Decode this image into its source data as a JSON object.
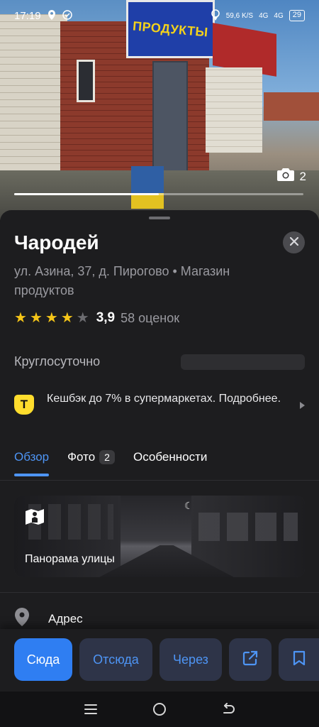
{
  "status_bar": {
    "time": "17:19",
    "network_speed": "59,6 K/S",
    "signal_1": "4G",
    "signal_2": "4G",
    "battery": "29"
  },
  "photo": {
    "sign_text": "ПРОДУКТЫ",
    "count": "2",
    "progress_fraction": 0.5
  },
  "place": {
    "title": "Чародей",
    "subtitle": "ул. Азина, 37, д. Пирогово • Магазин продуктов",
    "rating": "3,9",
    "rating_count": "58 оценок",
    "stars_filled": 4,
    "stars_total": 5,
    "hours": "Круглосуточно"
  },
  "promo": {
    "badge": "Т",
    "text": "Кешбэк до 7% в супермаркетах. Подробнее."
  },
  "tabs": [
    {
      "label": "Обзор",
      "active": true
    },
    {
      "label": "Фото",
      "badge": "2"
    },
    {
      "label": "Особенности"
    }
  ],
  "panorama": {
    "label": "Панорама улицы"
  },
  "address": {
    "label": "Адрес"
  },
  "actions": {
    "to_here": "Сюда",
    "from_here": "Отсюда",
    "via": "Через"
  },
  "colors": {
    "accent": "#4e95f5",
    "primary_button": "#2f7ef2",
    "star_filled": "#f5c518",
    "star_empty": "#6c6c70",
    "background": "#1d1d1f"
  },
  "icons": {
    "close": "close-icon",
    "camera": "camera-icon",
    "share": "share-icon",
    "bookmark": "bookmark-icon",
    "location": "location-pin-icon"
  }
}
